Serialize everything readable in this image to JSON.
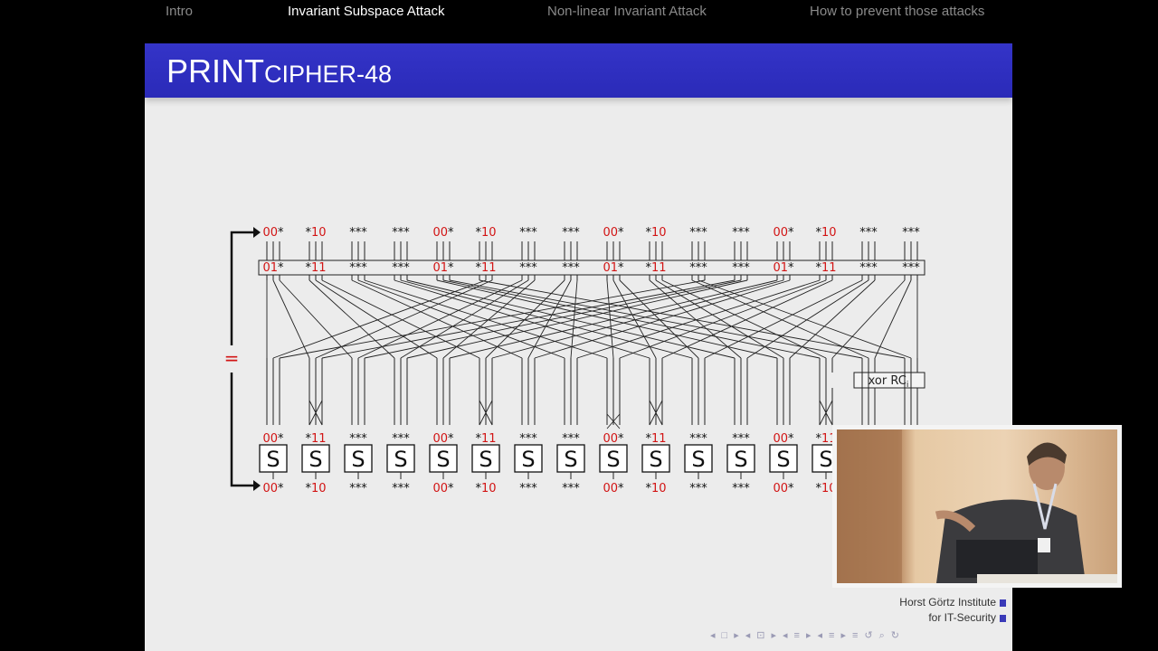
{
  "nav": {
    "items": [
      "Intro",
      "Invariant Subspace Attack",
      "Non-linear Invariant Attack",
      "How to prevent those attacks"
    ],
    "active_index": 1
  },
  "slide": {
    "title_main": "PRINT",
    "title_smallcaps": "CIPHER-48"
  },
  "diagram": {
    "top_labels": [
      "00*",
      "*10",
      "***",
      "***",
      "00*",
      "*10",
      "***",
      "***",
      "00*",
      "*10",
      "***",
      "***",
      "00*",
      "*10",
      "***",
      "***"
    ],
    "key_labels": [
      "01*",
      "*11",
      "***",
      "***",
      "01*",
      "*11",
      "***",
      "***",
      "01*",
      "*11",
      "***",
      "***",
      "01*",
      "*11",
      "***",
      "***"
    ],
    "sbox_input_labels": [
      "00*",
      "*11",
      "***",
      "***",
      "00*",
      "*11",
      "***",
      "***",
      "00*",
      "*11",
      "***",
      "***",
      "00*",
      "*11"
    ],
    "sbox_label": "S",
    "bottom_labels": [
      "00*",
      "*10",
      "***",
      "***",
      "00*",
      "*10",
      "***",
      "***",
      "00*",
      "*10",
      "***",
      "***",
      "00*",
      "*10"
    ],
    "xor_label": "xor RC",
    "xor_subscript": "i",
    "equal_sign": "="
  },
  "footer": {
    "institute_line1": "Horst Görtz Institute",
    "institute_line2": "for IT-Security"
  },
  "beamer_nav": [
    "◂",
    "□",
    "▸",
    "◂",
    "⊡",
    "▸",
    "◂",
    "≡",
    "▸",
    "◂",
    "≡",
    "▸",
    "≡",
    "↺",
    "⌕",
    "↻"
  ],
  "colors": {
    "title_bar": "#2f2fc0",
    "slide_bg": "#ececec",
    "highlight_red": "#d21414"
  },
  "video": {
    "subject": "speaker-camera-overlay"
  }
}
